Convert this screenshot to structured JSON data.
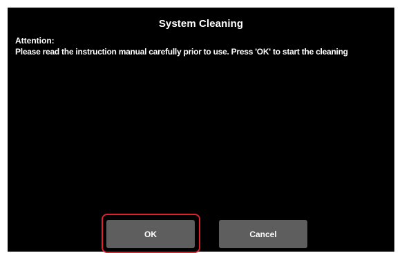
{
  "dialog": {
    "title": "System Cleaning",
    "attention_heading": "Attention:",
    "message": "Please read the instruction manual carefully  prior to use. Press 'OK' to start the cleaning"
  },
  "buttons": {
    "ok_label": "OK",
    "cancel_label": "Cancel"
  },
  "colors": {
    "screen_background": "#000000",
    "button_background": "#5e5e5e",
    "highlight_border": "#e0202a",
    "text": "#ffffff"
  }
}
